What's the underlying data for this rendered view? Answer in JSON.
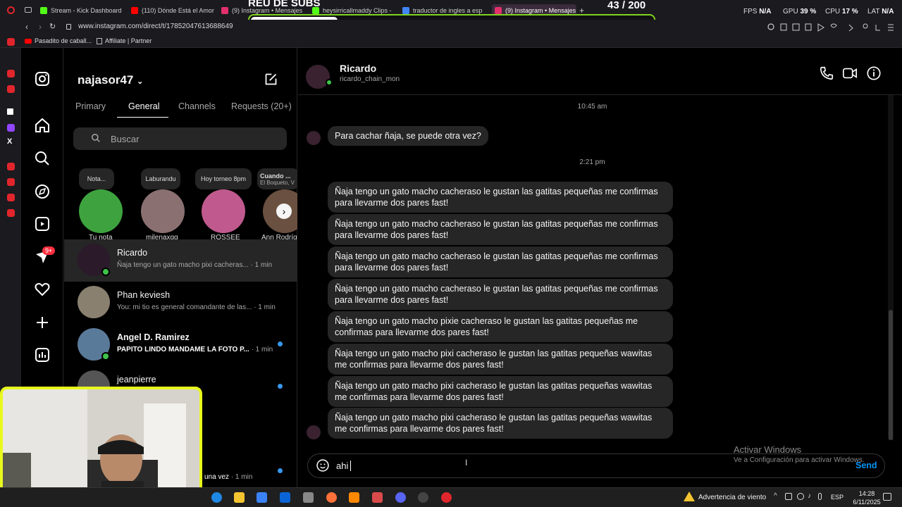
{
  "browser": {
    "tabs": [
      {
        "label": "Stream - Kick Dashboard",
        "color": "#53fc18"
      },
      {
        "label": "(110) Dónde Está el Amor",
        "color": "#ff0000"
      },
      {
        "label": "(9) Instagram • Mensajes",
        "color": "#e1306c"
      },
      {
        "label": "heysirricallmaddy Clips -",
        "color": "#53fc18"
      },
      {
        "label": "traductor de ingles a esp",
        "color": "#4285f4"
      },
      {
        "label": "(9) Instagram • Mensajes",
        "color": "#e1306c"
      }
    ],
    "url": "www.instagram.com/direct/t/17852047613688649",
    "bookmarks": [
      "Pasadito de caball...",
      "Affiliate | Partner"
    ]
  },
  "overlay": {
    "title": "REU DE SUBS",
    "count": "43",
    "total": "/ 200",
    "progress": 0.215,
    "stats": [
      {
        "label": "FPS",
        "value": "N/A"
      },
      {
        "label": "GPU",
        "value": "39 %"
      },
      {
        "label": "CPU",
        "value": "17 %"
      },
      {
        "label": "LAT",
        "value": "N/A"
      }
    ]
  },
  "inbox": {
    "username": "najasor47",
    "tabs": [
      "Primary",
      "General",
      "Channels",
      "Requests (20+)"
    ],
    "active_tab": "General",
    "search_placeholder": "Buscar",
    "notes": [
      {
        "bubble": "Nota...",
        "name": "Tu nota",
        "color": "#3ea33e"
      },
      {
        "bubble": "Laburandu",
        "name": "milenaxgg",
        "color": "#8a7070"
      },
      {
        "bubble": "Hoy torneo 8pm",
        "name": "ROSSEE",
        "color": "#c05a8e"
      },
      {
        "bubble": "Cuando ...",
        "bubble_sub": "El Boqueto, V",
        "name": "Ann Rodríg",
        "color": "#6a5040"
      }
    ],
    "conversations": [
      {
        "name": "Ricardo",
        "preview": "Ñaja tengo un gato macho pixi cacheras...",
        "time": "· 1 min",
        "selected": true,
        "online": true,
        "unread": false,
        "color": "#2a1a2a"
      },
      {
        "name": "Phan keviesh",
        "preview": "You: mi tio es general comandante de las...",
        "time": "· 1 min",
        "selected": false,
        "online": false,
        "unread": false,
        "color": "#8a8070"
      },
      {
        "name": "Angel D. Ramirez",
        "preview": "PAPITO LINDO MANDAME LA FOTO P...",
        "time": "· 1 min",
        "selected": false,
        "online": true,
        "unread": true,
        "color": "#5a7a9a"
      },
      {
        "name": "jeanpierre",
        "preview": "",
        "time": "",
        "selected": false,
        "online": false,
        "unread": true,
        "color": "#555"
      }
    ],
    "hidden_preview": "una vez",
    "hidden_time": "· 1 min",
    "notif_count": "9+"
  },
  "chat": {
    "name": "Ricardo",
    "handle": "ricardo_chain_mon",
    "timestamps": [
      "10:45 am",
      "2:21 pm"
    ],
    "first_message": "Para cachar ñaja, se puede otra vez?",
    "messages": [
      "Ñaja tengo un gato macho cacheraso le gustan las gatitas pequeñas me confirmas para llevarme dos pares fast!",
      "Ñaja tengo un gato macho cacheraso le gustan las gatitas pequeñas me confirmas para llevarme dos pares fast!",
      "Ñaja tengo un gato macho cacheraso le gustan las gatitas pequeñas me confirmas para llevarme dos pares fast!",
      "Ñaja tengo un gato macho cacheraso le gustan las gatitas pequeñas me confirmas para llevarme dos pares fast!",
      "Ñaja tengo un gato macho pixie cacheraso le gustan las gatitas pequeñas me confirmas para llevarme dos pares fast!",
      "Ñaja tengo un gato macho pixi cacheraso le gustan las gatitas pequeñas wawitas me confirmas para llevarme dos pares fast!",
      "Ñaja tengo un gato macho pixi cacheraso le gustan las gatitas pequeñas wawitas me confirmas para llevarme dos pares fast!",
      "Ñaja tengo un gato macho pixi cacheraso le gustan las gatitas pequeñas wawitas me confirmas para llevarme dos pares fast!"
    ],
    "composer_value": "ahi",
    "send_label": "Send"
  },
  "watermark": {
    "line1": "Activar Windows",
    "line2": "Ve a Configuración para activar Windows."
  },
  "taskbar": {
    "weather": "Advertencia de viento",
    "lang": "ESP",
    "time": "14:28",
    "date": "6/11/2025"
  }
}
